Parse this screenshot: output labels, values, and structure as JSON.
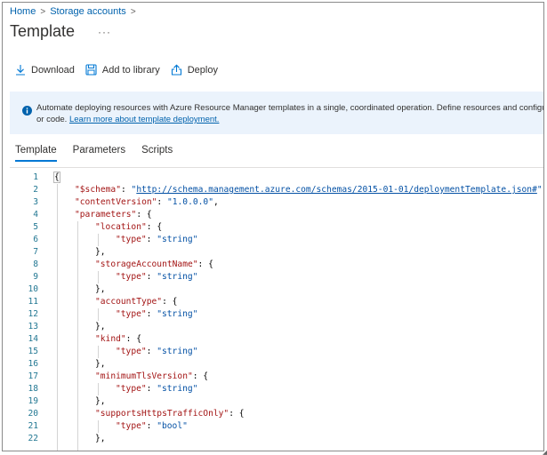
{
  "breadcrumb": {
    "items": [
      "Home",
      "Storage accounts"
    ]
  },
  "header": {
    "title": "Template",
    "more": "···"
  },
  "toolbar": {
    "download_label": "Download",
    "add_to_library_label": "Add to library",
    "deploy_label": "Deploy"
  },
  "banner": {
    "line1": "Automate deploying resources with Azure Resource Manager templates in a single, coordinated operation. Define resources and configurable input",
    "line2_prefix": "or code. ",
    "link_text": "Learn more about template deployment."
  },
  "tabs": [
    {
      "label": "Template",
      "active": true
    },
    {
      "label": "Parameters",
      "active": false
    },
    {
      "label": "Scripts",
      "active": false
    }
  ],
  "editor": {
    "lines": [
      {
        "n": "1",
        "indent": 0,
        "tokens": [
          {
            "t": "p",
            "v": "{"
          }
        ]
      },
      {
        "n": "2",
        "indent": 1,
        "tokens": [
          {
            "t": "k",
            "v": "\"$schema\""
          },
          {
            "t": "p",
            "v": ": "
          },
          {
            "t": "s",
            "v": "\""
          },
          {
            "t": "u",
            "v": "http://schema.management.azure.com/schemas/2015-01-01/deploymentTemplate.json#"
          },
          {
            "t": "s",
            "v": "\""
          },
          {
            "t": "p",
            "v": ","
          }
        ]
      },
      {
        "n": "3",
        "indent": 1,
        "tokens": [
          {
            "t": "k",
            "v": "\"contentVersion\""
          },
          {
            "t": "p",
            "v": ": "
          },
          {
            "t": "s",
            "v": "\"1.0.0.0\""
          },
          {
            "t": "p",
            "v": ","
          }
        ]
      },
      {
        "n": "4",
        "indent": 1,
        "tokens": [
          {
            "t": "k",
            "v": "\"parameters\""
          },
          {
            "t": "p",
            "v": ": {"
          }
        ]
      },
      {
        "n": "5",
        "indent": 2,
        "tokens": [
          {
            "t": "k",
            "v": "\"location\""
          },
          {
            "t": "p",
            "v": ": {"
          }
        ]
      },
      {
        "n": "6",
        "indent": 3,
        "tokens": [
          {
            "t": "k",
            "v": "\"type\""
          },
          {
            "t": "p",
            "v": ": "
          },
          {
            "t": "s",
            "v": "\"string\""
          }
        ]
      },
      {
        "n": "7",
        "indent": 2,
        "tokens": [
          {
            "t": "p",
            "v": "},"
          }
        ]
      },
      {
        "n": "8",
        "indent": 2,
        "tokens": [
          {
            "t": "k",
            "v": "\"storageAccountName\""
          },
          {
            "t": "p",
            "v": ": {"
          }
        ]
      },
      {
        "n": "9",
        "indent": 3,
        "tokens": [
          {
            "t": "k",
            "v": "\"type\""
          },
          {
            "t": "p",
            "v": ": "
          },
          {
            "t": "s",
            "v": "\"string\""
          }
        ]
      },
      {
        "n": "10",
        "indent": 2,
        "tokens": [
          {
            "t": "p",
            "v": "},"
          }
        ]
      },
      {
        "n": "11",
        "indent": 2,
        "tokens": [
          {
            "t": "k",
            "v": "\"accountType\""
          },
          {
            "t": "p",
            "v": ": {"
          }
        ]
      },
      {
        "n": "12",
        "indent": 3,
        "tokens": [
          {
            "t": "k",
            "v": "\"type\""
          },
          {
            "t": "p",
            "v": ": "
          },
          {
            "t": "s",
            "v": "\"string\""
          }
        ]
      },
      {
        "n": "13",
        "indent": 2,
        "tokens": [
          {
            "t": "p",
            "v": "},"
          }
        ]
      },
      {
        "n": "14",
        "indent": 2,
        "tokens": [
          {
            "t": "k",
            "v": "\"kind\""
          },
          {
            "t": "p",
            "v": ": {"
          }
        ]
      },
      {
        "n": "15",
        "indent": 3,
        "tokens": [
          {
            "t": "k",
            "v": "\"type\""
          },
          {
            "t": "p",
            "v": ": "
          },
          {
            "t": "s",
            "v": "\"string\""
          }
        ]
      },
      {
        "n": "16",
        "indent": 2,
        "tokens": [
          {
            "t": "p",
            "v": "},"
          }
        ]
      },
      {
        "n": "17",
        "indent": 2,
        "tokens": [
          {
            "t": "k",
            "v": "\"minimumTlsVersion\""
          },
          {
            "t": "p",
            "v": ": {"
          }
        ]
      },
      {
        "n": "18",
        "indent": 3,
        "tokens": [
          {
            "t": "k",
            "v": "\"type\""
          },
          {
            "t": "p",
            "v": ": "
          },
          {
            "t": "s",
            "v": "\"string\""
          }
        ]
      },
      {
        "n": "19",
        "indent": 2,
        "tokens": [
          {
            "t": "p",
            "v": "},"
          }
        ]
      },
      {
        "n": "20",
        "indent": 2,
        "tokens": [
          {
            "t": "k",
            "v": "\"supportsHttpsTrafficOnly\""
          },
          {
            "t": "p",
            "v": ": {"
          }
        ]
      },
      {
        "n": "21",
        "indent": 3,
        "tokens": [
          {
            "t": "k",
            "v": "\"type\""
          },
          {
            "t": "p",
            "v": ": "
          },
          {
            "t": "s",
            "v": "\"bool\""
          }
        ]
      },
      {
        "n": "22",
        "indent": 2,
        "tokens": [
          {
            "t": "p",
            "v": "},"
          }
        ]
      }
    ]
  },
  "colors": {
    "link": "#0062ad",
    "accent": "#0078d4",
    "banner_bg": "#ebf3fc",
    "json_key": "#a31515",
    "json_string": "#0451a5",
    "line_number": "#237893"
  },
  "icons": {
    "download": "download-icon",
    "library": "save-to-library-icon",
    "deploy": "deploy-upload-icon",
    "info": "info-icon"
  }
}
